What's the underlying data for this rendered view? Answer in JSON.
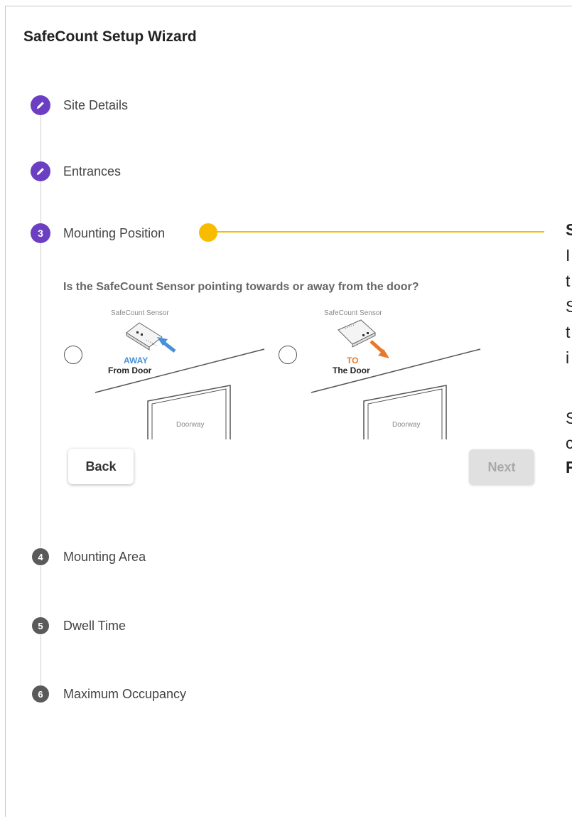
{
  "wizard": {
    "title": "SafeCount Setup Wizard",
    "steps": [
      {
        "number": "",
        "label": "Site Details",
        "state": "completed",
        "icon": "pencil-icon"
      },
      {
        "number": "",
        "label": "Entrances",
        "state": "completed",
        "icon": "pencil-icon"
      },
      {
        "number": "3",
        "label": "Mounting Position",
        "state": "active"
      },
      {
        "number": "4",
        "label": "Mounting Area",
        "state": "pending"
      },
      {
        "number": "5",
        "label": "Dwell Time",
        "state": "pending"
      },
      {
        "number": "6",
        "label": "Maximum Occupancy",
        "state": "pending"
      }
    ],
    "question": "Is the SafeCount Sensor pointing towards or away from the door?",
    "options": [
      {
        "sensor_caption": "SafeCount Sensor",
        "direction_word": "AWAY",
        "direction_text": "From Door",
        "door_label": "Doorway",
        "accent_color": "#4a90d9",
        "selected": false
      },
      {
        "sensor_caption": "SafeCount Sensor",
        "direction_word": "TO",
        "direction_text": "The Door",
        "door_label": "Doorway",
        "accent_color": "#e8792b",
        "selected": false
      }
    ],
    "back_label": "Back",
    "next_label": "Next"
  },
  "callout": {
    "color": "#f7bc00",
    "lines": [
      "S",
      "I",
      "t",
      "S",
      "t",
      "i",
      "",
      "S",
      "c",
      "R"
    ]
  },
  "colors": {
    "step_done": "#6a3fc1",
    "step_pending": "#5a5a5a"
  }
}
